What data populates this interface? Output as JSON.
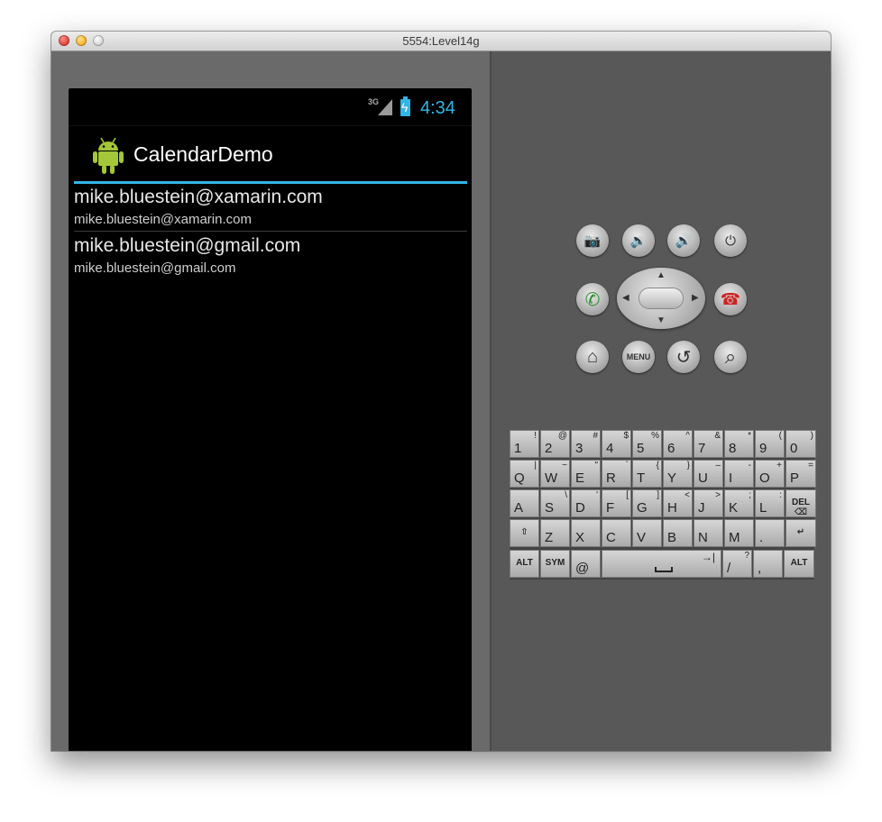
{
  "window": {
    "title": "5554:Level14g"
  },
  "status_bar": {
    "network": "3G",
    "time": "4:34"
  },
  "action_bar": {
    "app_name": "CalendarDemo"
  },
  "accounts": [
    {
      "title": "mike.bluestein@xamarin.com",
      "subtitle": "mike.bluestein@xamarin.com"
    },
    {
      "title": "mike.bluestein@gmail.com",
      "subtitle": "mike.bluestein@gmail.com"
    }
  ],
  "hardware_buttons": {
    "camera_icon": "📷",
    "volume_down_icon": "🔉",
    "volume_up_icon": "🔊",
    "power_icon": "⏻",
    "call_icon": "✆",
    "end_call_icon": "☎",
    "home_icon": "⌂",
    "menu_label": "MENU",
    "back_icon": "↺",
    "search_icon": "⌕"
  },
  "keyboard": {
    "rows": [
      [
        {
          "m": "1",
          "s": "!"
        },
        {
          "m": "2",
          "s": "@"
        },
        {
          "m": "3",
          "s": "#"
        },
        {
          "m": "4",
          "s": "$"
        },
        {
          "m": "5",
          "s": "%"
        },
        {
          "m": "6",
          "s": "^"
        },
        {
          "m": "7",
          "s": "&"
        },
        {
          "m": "8",
          "s": "*"
        },
        {
          "m": "9",
          "s": "("
        },
        {
          "m": "0",
          "s": ")"
        }
      ],
      [
        {
          "m": "Q",
          "s": "|"
        },
        {
          "m": "W",
          "s": "~"
        },
        {
          "m": "E",
          "s": "\""
        },
        {
          "m": "R",
          "s": "`"
        },
        {
          "m": "T",
          "s": "{"
        },
        {
          "m": "Y",
          "s": "}"
        },
        {
          "m": "U",
          "s": "–"
        },
        {
          "m": "I",
          "s": "-"
        },
        {
          "m": "O",
          "s": "+"
        },
        {
          "m": "P",
          "s": "="
        }
      ],
      [
        {
          "m": "A",
          "s": ""
        },
        {
          "m": "S",
          "s": "\\"
        },
        {
          "m": "D",
          "s": "'"
        },
        {
          "m": "F",
          "s": "["
        },
        {
          "m": "G",
          "s": "]"
        },
        {
          "m": "H",
          "s": "<"
        },
        {
          "m": "J",
          "s": ">"
        },
        {
          "m": "K",
          "s": ";"
        },
        {
          "m": "L",
          "s": ":"
        },
        {
          "c": "DEL ⌫"
        }
      ],
      [
        {
          "c": "⇧"
        },
        {
          "m": "Z",
          "s": ""
        },
        {
          "m": "X",
          "s": ""
        },
        {
          "m": "C",
          "s": ""
        },
        {
          "m": "V",
          "s": ""
        },
        {
          "m": "B",
          "s": ""
        },
        {
          "m": "N",
          "s": ""
        },
        {
          "m": "M",
          "s": ""
        },
        {
          "m": ".",
          "s": ""
        },
        {
          "c": "↵"
        }
      ]
    ],
    "bottom_row": {
      "alt_left": "ALT",
      "sym": "SYM",
      "at": "@",
      "tab": "→|",
      "slash": "/",
      "question": "?",
      "comma": ",",
      "alt_right": "ALT"
    }
  }
}
